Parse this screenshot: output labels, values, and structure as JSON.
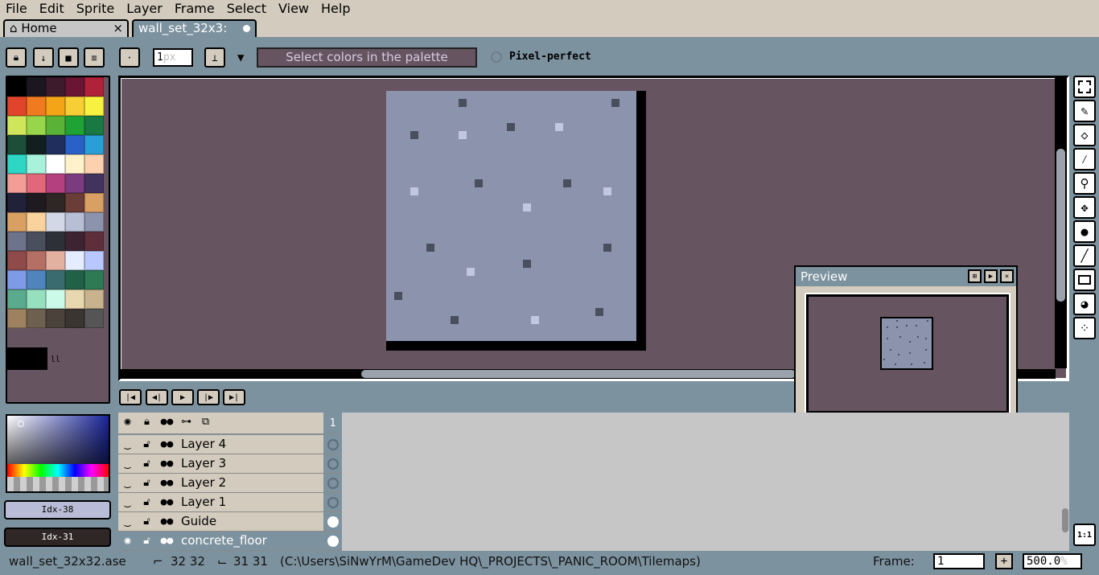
{
  "menu": [
    "File",
    "Edit",
    "Sprite",
    "Layer",
    "Frame",
    "Select",
    "View",
    "Help"
  ],
  "tabs": {
    "home": "Home",
    "home_close": "×",
    "file": "wall_set_32x3:"
  },
  "toolbar": {
    "brush_size": "1",
    "brush_unit": "px",
    "palette_hint": "Select colors in the palette",
    "pixel_perfect": "Pixel-perfect"
  },
  "palette": [
    "#000000",
    "#1a1720",
    "#3d1a2c",
    "#6a1533",
    "#b0213a",
    "#e0452b",
    "#f07a1f",
    "#f4a417",
    "#f7cf35",
    "#f7f23f",
    "#cfe65a",
    "#97d64a",
    "#5ab236",
    "#20a335",
    "#187a42",
    "#1d4e39",
    "#121f1e",
    "#1f2e5c",
    "#2a61c8",
    "#2a9ed6",
    "#2dd6c5",
    "#a8f2dc",
    "#ffffff",
    "#fff1c9",
    "#fbd1b0",
    "#f29e96",
    "#e0687a",
    "#b5407f",
    "#7a3c7e",
    "#41325e",
    "#22213a",
    "#1f1a1f",
    "#2e2725",
    "#6b3d38",
    "#d9a064",
    "#d9a064",
    "#fad29e",
    "#d3d8e6",
    "#b6bfd4",
    "#8c93ad",
    "#6c738a",
    "#4a4f5e",
    "#2e3038",
    "#3e2433",
    "#5e2f3a",
    "#8f4a4a",
    "#b57066",
    "#e3b1a0",
    "#e4ecff",
    "#b8c7ff",
    "#7f9ae6",
    "#4f84bd",
    "#3a6b6e",
    "#216148",
    "#2d7a55",
    "#5aab8e",
    "#96e0bf",
    "#ccfae8",
    "#e8d8b0",
    "#c9b38f",
    "#9e8260",
    "#6e604e",
    "#4a423b",
    "#3a3530",
    "#555555"
  ],
  "color_picker": {
    "fg_index": "Idx-38",
    "bg_index": "Idx-31"
  },
  "layers": [
    {
      "name": "Layer 4",
      "sel": false
    },
    {
      "name": "Layer 3",
      "sel": false
    },
    {
      "name": "Layer 2",
      "sel": false
    },
    {
      "name": "Layer 1",
      "sel": false
    },
    {
      "name": "Guide",
      "sel": false
    },
    {
      "name": "concrete_floor",
      "sel": true
    }
  ],
  "frame_header": "1",
  "preview": {
    "title": "Preview"
  },
  "status": {
    "filename": "wall_set_32x32.ase",
    "size": "32 32",
    "pos": "31 31",
    "path": "(C:\\Users\\SiNwYrM\\GameDev HQ\\_PROJECTS\\_PANIC_ROOM\\Tilemaps)",
    "frame_label": "Frame:",
    "frame_value": "1",
    "frame_add": "+",
    "zoom": "500.0",
    "zoom_unit": "%"
  },
  "colors": {
    "canvas_bg": "#665561",
    "sprite": "#8c93ad",
    "dark_px": "#4a4f5e",
    "light_px": "#c1c7e0",
    "chrome": "#7d929f"
  },
  "one_to_one": "1:1"
}
